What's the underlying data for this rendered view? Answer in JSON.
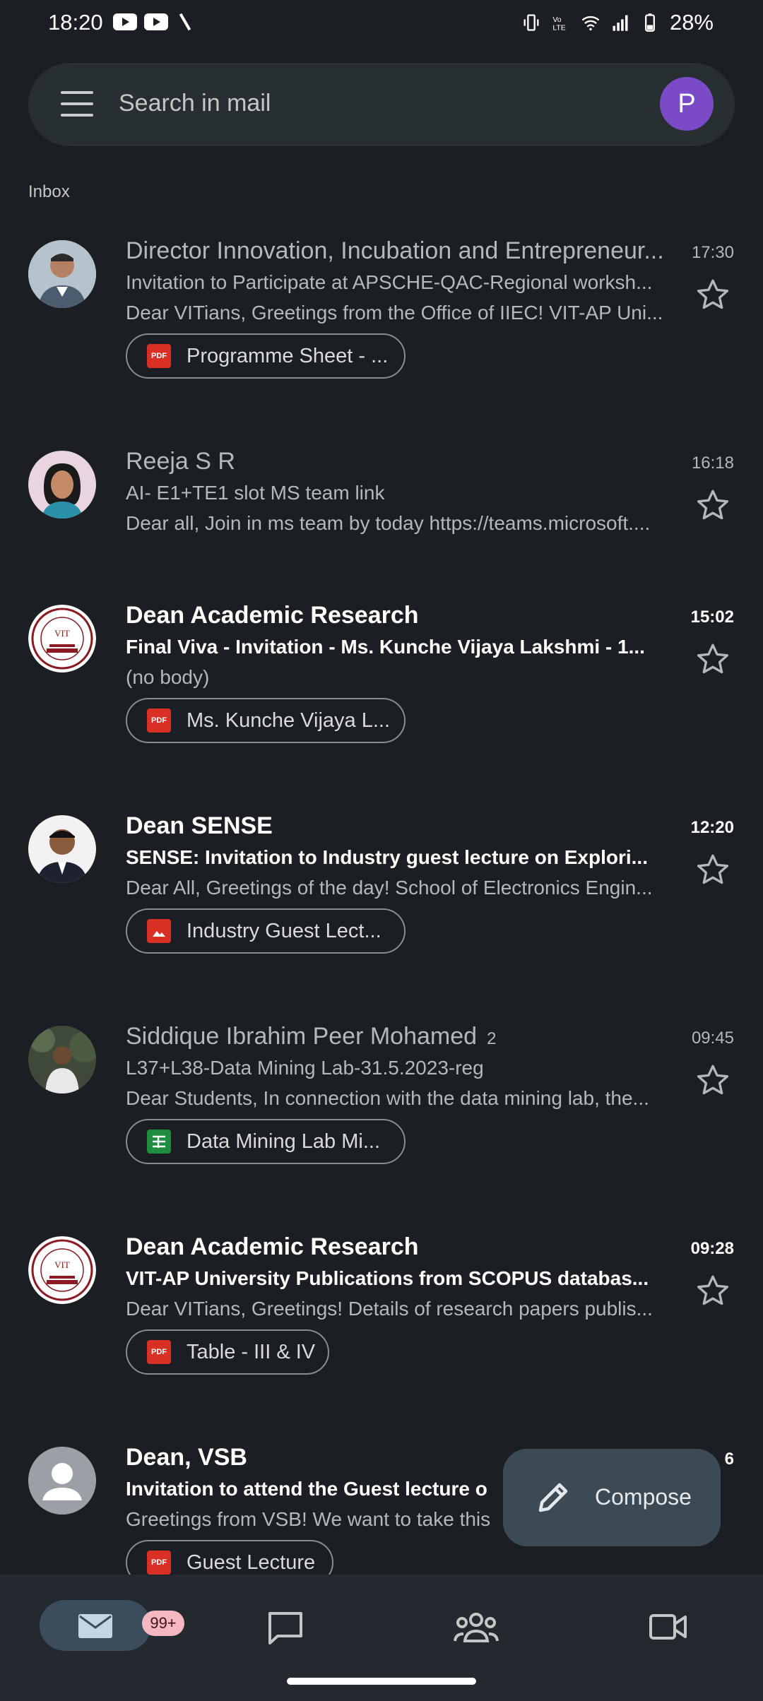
{
  "status_bar": {
    "time": "18:20",
    "battery": "28%"
  },
  "search": {
    "placeholder": "Search in mail",
    "avatar_letter": "P"
  },
  "section_label": "Inbox",
  "emails": [
    {
      "sender": "Director Innovation, Incubation and Entrepreneur...",
      "time": "17:30",
      "subject": "Invitation to Participate at APSCHE-QAC-Regional worksh...",
      "snippet": "Dear VITians, Greetings from the Office of IIEC! VIT-AP Uni...",
      "attachment": "Programme Sheet - ...",
      "attachment_type": "pdf-icon"
    },
    {
      "sender": "Reeja S R",
      "time": "16:18",
      "subject": "AI- E1+TE1 slot MS team link",
      "snippet": "Dear all, Join in ms team by today https://teams.microsoft...."
    },
    {
      "sender": "Dean Academic Research",
      "time": "15:02",
      "subject": "Final Viva - Invitation - Ms. Kunche Vijaya Lakshmi - 1...",
      "snippet": "(no body)",
      "attachment": "Ms. Kunche Vijaya L...",
      "attachment_type": "pdf-icon"
    },
    {
      "sender": "Dean SENSE",
      "time": "12:20",
      "subject": "SENSE: Invitation to Industry guest lecture on Explori...",
      "snippet": "Dear All, Greetings of the day! School of Electronics Engin...",
      "attachment": "Industry Guest Lect...",
      "attachment_type": "image-icon"
    },
    {
      "sender": "Siddique Ibrahim Peer Mohamed",
      "count": "2",
      "time": "09:45",
      "subject": "L37+L38-Data Mining Lab-31.5.2023-reg",
      "snippet": "Dear Students, In connection with the data mining lab, the...",
      "attachment": "Data Mining Lab Mi...",
      "attachment_type": "sheets-icon"
    },
    {
      "sender": "Dean Academic Research",
      "time": "09:28",
      "subject": "VIT-AP University Publications from SCOPUS databas...",
      "snippet": "Dear VITians, Greetings! Details of research papers publis...",
      "attachment": "Table - III & IV",
      "attachment_type": "pdf-icon"
    },
    {
      "sender": "Dean, VSB",
      "time": "6",
      "subject": "Invitation to attend the Guest lecture o",
      "snippet": "Greetings from VSB! We want to take this",
      "attachment": "Guest Lecture"
    }
  ],
  "compose": {
    "label": "Compose"
  },
  "nav": {
    "mail_badge": "99+"
  },
  "colors": {
    "background": "#1b1e22",
    "search_bar": "#282f33",
    "avatar": "#7b4bc7",
    "badge": "#f5b8c0",
    "pdf": "#d93025",
    "sheets": "#1e8e3e"
  }
}
